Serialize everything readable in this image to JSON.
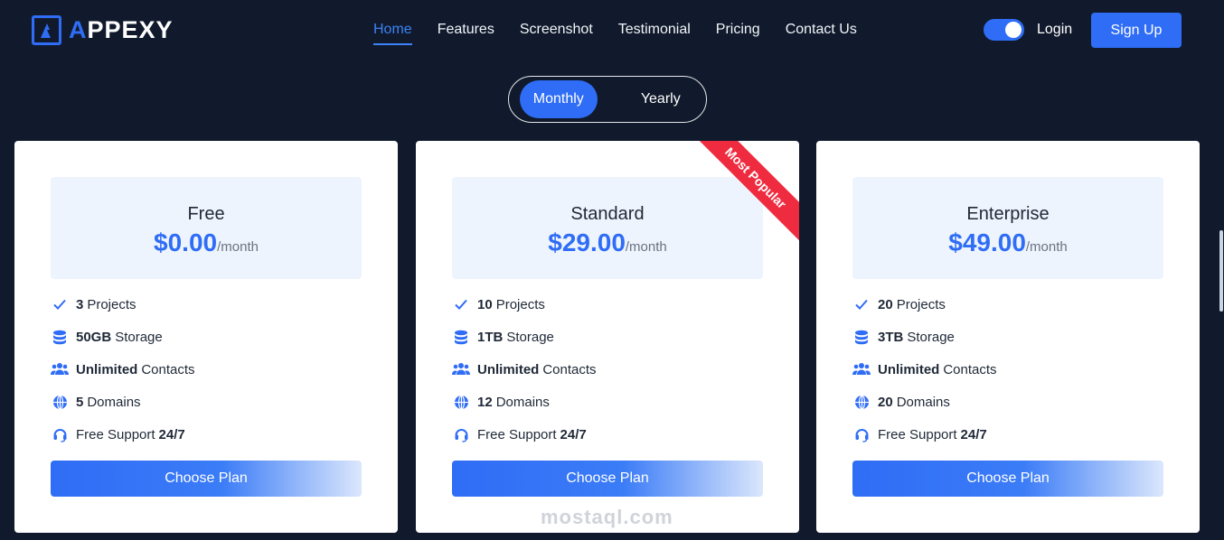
{
  "brand": {
    "first": "A",
    "rest": "PPEXY",
    "accent": "#2f6df6"
  },
  "nav": {
    "items": [
      {
        "label": "Home",
        "active": true
      },
      {
        "label": "Features"
      },
      {
        "label": "Screenshot"
      },
      {
        "label": "Testimonial"
      },
      {
        "label": "Pricing"
      },
      {
        "label": "Contact Us"
      }
    ],
    "login": "Login",
    "signup": "Sign Up",
    "theme_toggle": "on"
  },
  "billing": {
    "monthly": "Monthly",
    "yearly": "Yearly",
    "selected": "Monthly"
  },
  "plans": [
    {
      "name": "Free",
      "price": "$0.00",
      "period": "/month",
      "features": [
        {
          "icon": "check-icon",
          "bold": "3",
          "text": "Projects"
        },
        {
          "icon": "database-icon",
          "bold": "50GB",
          "text": "Storage"
        },
        {
          "icon": "users-icon",
          "bold": "Unlimited",
          "text": "Contacts"
        },
        {
          "icon": "globe-icon",
          "bold": "5",
          "text": "Domains"
        },
        {
          "icon": "headset-icon",
          "text": "Free Support",
          "bold_after": "24/7"
        }
      ],
      "cta": "Choose Plan"
    },
    {
      "name": "Standard",
      "price": "$29.00",
      "period": "/month",
      "ribbon": "Most Popular",
      "features": [
        {
          "icon": "check-icon",
          "bold": "10",
          "text": "Projects"
        },
        {
          "icon": "database-icon",
          "bold": "1TB",
          "text": "Storage"
        },
        {
          "icon": "users-icon",
          "bold": "Unlimited",
          "text": "Contacts"
        },
        {
          "icon": "globe-icon",
          "bold": "12",
          "text": "Domains"
        },
        {
          "icon": "headset-icon",
          "text": "Free Support",
          "bold_after": "24/7"
        }
      ],
      "cta": "Choose Plan"
    },
    {
      "name": "Enterprise",
      "price": "$49.00",
      "period": "/month",
      "features": [
        {
          "icon": "check-icon",
          "bold": "20",
          "text": "Projects"
        },
        {
          "icon": "database-icon",
          "bold": "3TB",
          "text": "Storage"
        },
        {
          "icon": "users-icon",
          "bold": "Unlimited",
          "text": "Contacts"
        },
        {
          "icon": "globe-icon",
          "bold": "20",
          "text": "Domains"
        },
        {
          "icon": "headset-icon",
          "text": "Free Support",
          "bold_after": "24/7"
        }
      ],
      "cta": "Choose Plan"
    }
  ],
  "watermark": "mostaql.com",
  "colors": {
    "background": "#111a2c",
    "primary": "#2f6df6",
    "ribbon": "#ef2b3f",
    "card_head": "#eef4fd"
  }
}
